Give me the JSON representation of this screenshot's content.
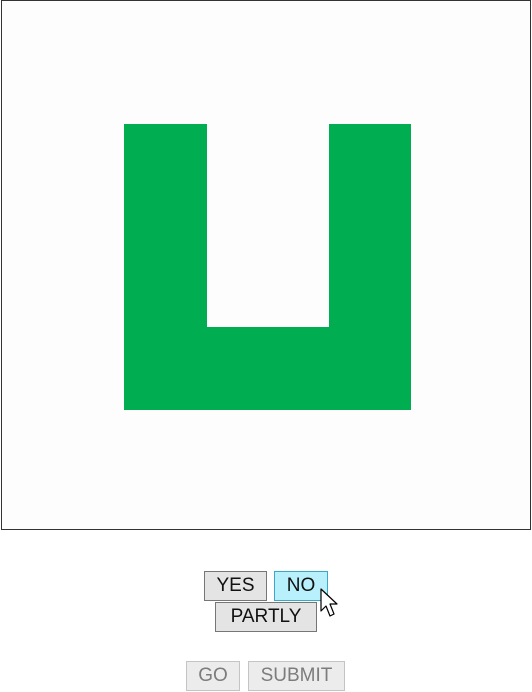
{
  "canvas": {
    "shape": "u-shape",
    "shape_color": "#00ad50",
    "background_color": "#fdfdfd"
  },
  "answers": {
    "yes_label": "YES",
    "no_label": "NO",
    "partly_label": "PARTLY",
    "selected": "NO"
  },
  "actions": {
    "go_label": "GO",
    "submit_label": "SUBMIT",
    "go_enabled": false,
    "submit_enabled": false
  },
  "cursor": {
    "icon": "mouse-pointer-icon"
  },
  "colors": {
    "selected_button": "#b8f0fb",
    "button": "#e4e4e4",
    "disabled_text": "#7c7c7c"
  }
}
